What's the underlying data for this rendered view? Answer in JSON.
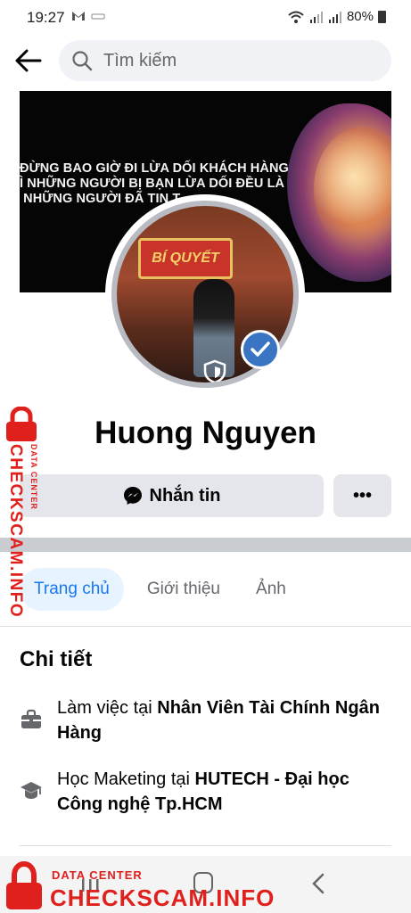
{
  "status_bar": {
    "time": "19:27",
    "battery": "80%",
    "icons": [
      "gmail-icon",
      "app-icon",
      "wifi-icon",
      "signal-icon",
      "signal-icon",
      "battery-icon"
    ]
  },
  "top_bar": {
    "back_icon": "arrow-left-icon",
    "search_placeholder": "Tìm kiếm"
  },
  "cover": {
    "quote": "ĐỪNG BAO GIỜ ĐI LỪA DỐI KHÁCH HÀNG\nÌ NHỮNG NGƯỜI BỊ BẠN LỪA DỐI ĐỀU LÀ\n NHỮNG NGƯỜI ĐÃ TIN T"
  },
  "avatar": {
    "sign_text": "BÍ QUYẾT"
  },
  "profile": {
    "name": "Huong Nguyen",
    "message_button": "Nhắn tin",
    "more_button": "•••"
  },
  "tabs": [
    {
      "label": "Trang chủ",
      "active": true
    },
    {
      "label": "Giới thiệu",
      "active": false
    },
    {
      "label": "Ảnh",
      "active": false
    }
  ],
  "details": {
    "title": "Chi tiết",
    "items": [
      {
        "icon": "briefcase-icon",
        "prefix": "Làm việc tại ",
        "bold": "Nhân Viên Tài Chính Ngân Hàng"
      },
      {
        "icon": "graduation-cap-icon",
        "prefix": "Học Maketing tại ",
        "bold": "HUTECH - Đại học Công nghệ Tp.HCM"
      }
    ]
  },
  "watermark": {
    "sub": "DATA CENTER",
    "main": "CHECKSCAM.INFO",
    "color": "#e0201c"
  },
  "colors": {
    "accent": "#1877f2",
    "button_bg": "#e4e6eb",
    "verified": "#3a75c4"
  }
}
